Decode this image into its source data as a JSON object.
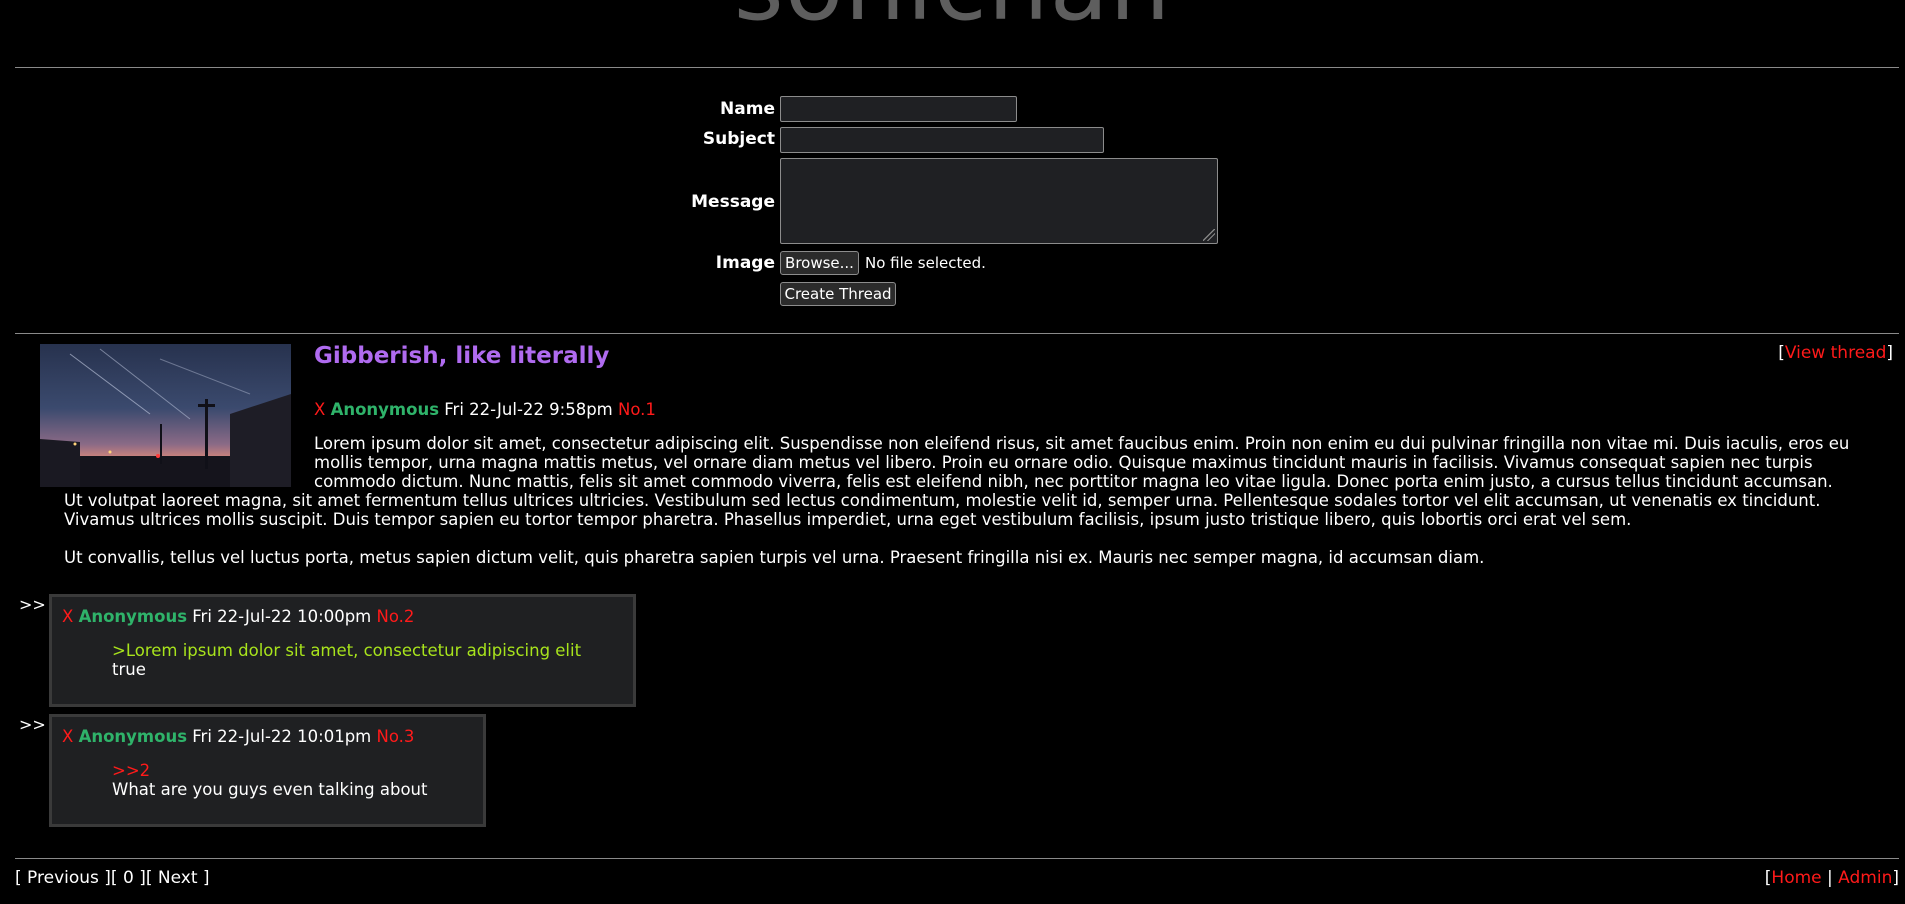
{
  "header": {
    "logo_text": "sonichan"
  },
  "form": {
    "name_label": "Name",
    "name_value": "",
    "subject_label": "Subject",
    "subject_value": "",
    "message_label": "Message",
    "message_value": "",
    "image_label": "Image",
    "browse_label": "Browse...",
    "file_status": "No file selected.",
    "submit_label": "Create Thread"
  },
  "thread": {
    "title": "Gibberish, like literally",
    "view_thread_label": "View thread",
    "op": {
      "delete_label": "X",
      "author": "Anonymous",
      "date": "Fri 22-Jul-22 9:58pm",
      "post_no": "No.1",
      "paragraph1": "Lorem ipsum dolor sit amet, consectetur adipiscing elit. Suspendisse non eleifend risus, sit amet faucibus enim. Proin non enim eu dui pulvinar fringilla non vitae mi. Duis iaculis, eros eu mollis tempor, urna magna mattis metus, vel ornare diam metus vel libero. Proin eu ornare odio. Quisque maximus tincidunt mauris in facilisis. Vivamus consequat sapien nec turpis commodo dictum. Nunc mattis, felis sit amet commodo viverra, felis est eleifend nibh, nec porttitor magna leo vitae ligula. Donec porta enim justo, a cursus tellus tincidunt accumsan. Ut volutpat laoreet magna, sit amet fermentum tellus ultrices ultricies. Vestibulum sed lectus condimentum, molestie velit id, semper urna. Pellentesque sodales tortor vel elit accumsan, ut venenatis ex tincidunt. Vivamus ultrices mollis suscipit. Duis tempor sapien eu tortor tempor pharetra. Phasellus imperdiet, urna eget vestibulum facilisis, ipsum justo tristique libero, quis lobortis orci erat vel sem.",
      "paragraph2": "Ut convallis, tellus vel luctus porta, metus sapien dictum velit, quis pharetra sapien turpis vel urna. Praesent fringilla nisi ex. Mauris nec semper magna, id accumsan diam."
    },
    "replies": [
      {
        "arrow": ">>",
        "delete_label": "X",
        "author": "Anonymous",
        "date": "Fri 22-Jul-22 10:00pm",
        "post_no": "No.2",
        "line1": ">Lorem ipsum dolor sit amet, consectetur adipiscing elit",
        "line2": "true"
      },
      {
        "arrow": ">>",
        "delete_label": "X",
        "author": "Anonymous",
        "date": "Fri 22-Jul-22 10:01pm",
        "post_no": "No.3",
        "line1": ">>2",
        "line2": "What are you guys even talking about"
      }
    ]
  },
  "footer": {
    "previous_label": "Previous",
    "page_number": "0",
    "next_label": "Next",
    "home_label": "Home",
    "admin_label": "Admin"
  },
  "colors": {
    "background": "#000000",
    "title_purple": "#b06bf0",
    "link_red": "#ff1a1a",
    "author_green": "#2fb36a",
    "greentext": "#a8e41c"
  }
}
